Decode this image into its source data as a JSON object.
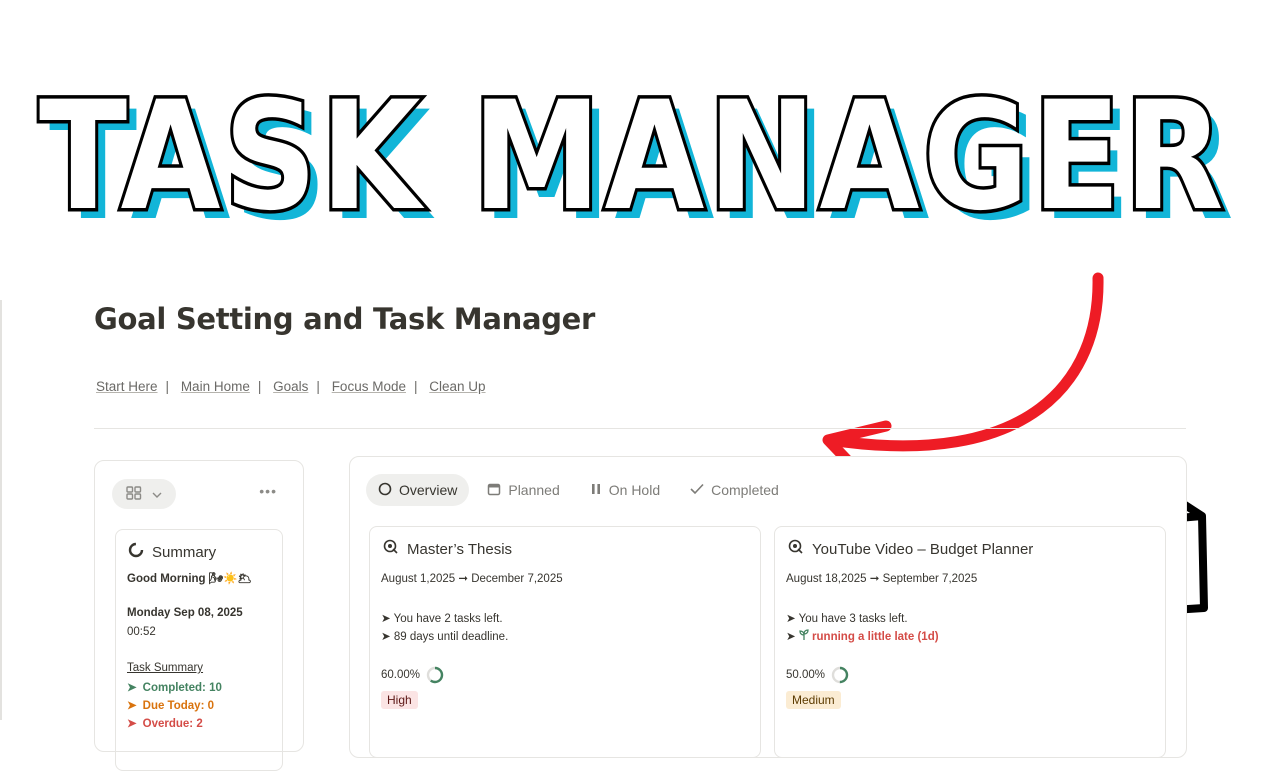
{
  "hero": {
    "title": "TASK MANAGER"
  },
  "page": {
    "title": "Goal Setting and Task Manager",
    "nav": [
      "Start Here",
      "Main Home",
      "Goals",
      "Focus Mode",
      "Clean Up"
    ]
  },
  "summary": {
    "title": "Summary",
    "greeting": "Good Morning 🌬☀️🌥",
    "date": "Monday Sep 08, 2025",
    "time": "00:52",
    "section_label": "Task Summary",
    "stats": [
      {
        "label": "Completed: 10",
        "color": "#448361"
      },
      {
        "label": "Due Today: 0",
        "color": "#d9730d"
      },
      {
        "label": "Overdue: 2",
        "color": "#d44c47"
      }
    ]
  },
  "tabs": [
    {
      "label": "Overview",
      "icon": "circle-icon",
      "active": true
    },
    {
      "label": "Planned",
      "icon": "calendar-icon",
      "active": false
    },
    {
      "label": "On Hold",
      "icon": "pause-icon",
      "active": false
    },
    {
      "label": "Completed",
      "icon": "check-icon",
      "active": false
    }
  ],
  "goals": [
    {
      "title": "Master’s Thesis",
      "dates": "August 1,2025 ➞ December 7,2025",
      "line1": "➤ You have 2 tasks left.",
      "line2": "➤ 89 days until deadline.",
      "progress": "60.00%",
      "progress_value": 0.6,
      "priority": "High",
      "priority_bg": "#fbe4e4",
      "priority_color": "#5d1715"
    },
    {
      "title": "YouTube Video – Budget Planner",
      "dates": "August 18,2025 ➞ September 7,2025",
      "line1": "➤ You have 3 tasks left.",
      "line2_icon": "sprout-icon",
      "line2": "running a little late (1d)",
      "progress": "50.00%",
      "progress_value": 0.5,
      "priority": "Medium",
      "priority_bg": "#fbecd3",
      "priority_color": "#5c3b00"
    }
  ],
  "colors": {
    "hero_cyan": "#12b5d8",
    "arrow_red": "#ee1c25",
    "progress_green": "#448361"
  }
}
